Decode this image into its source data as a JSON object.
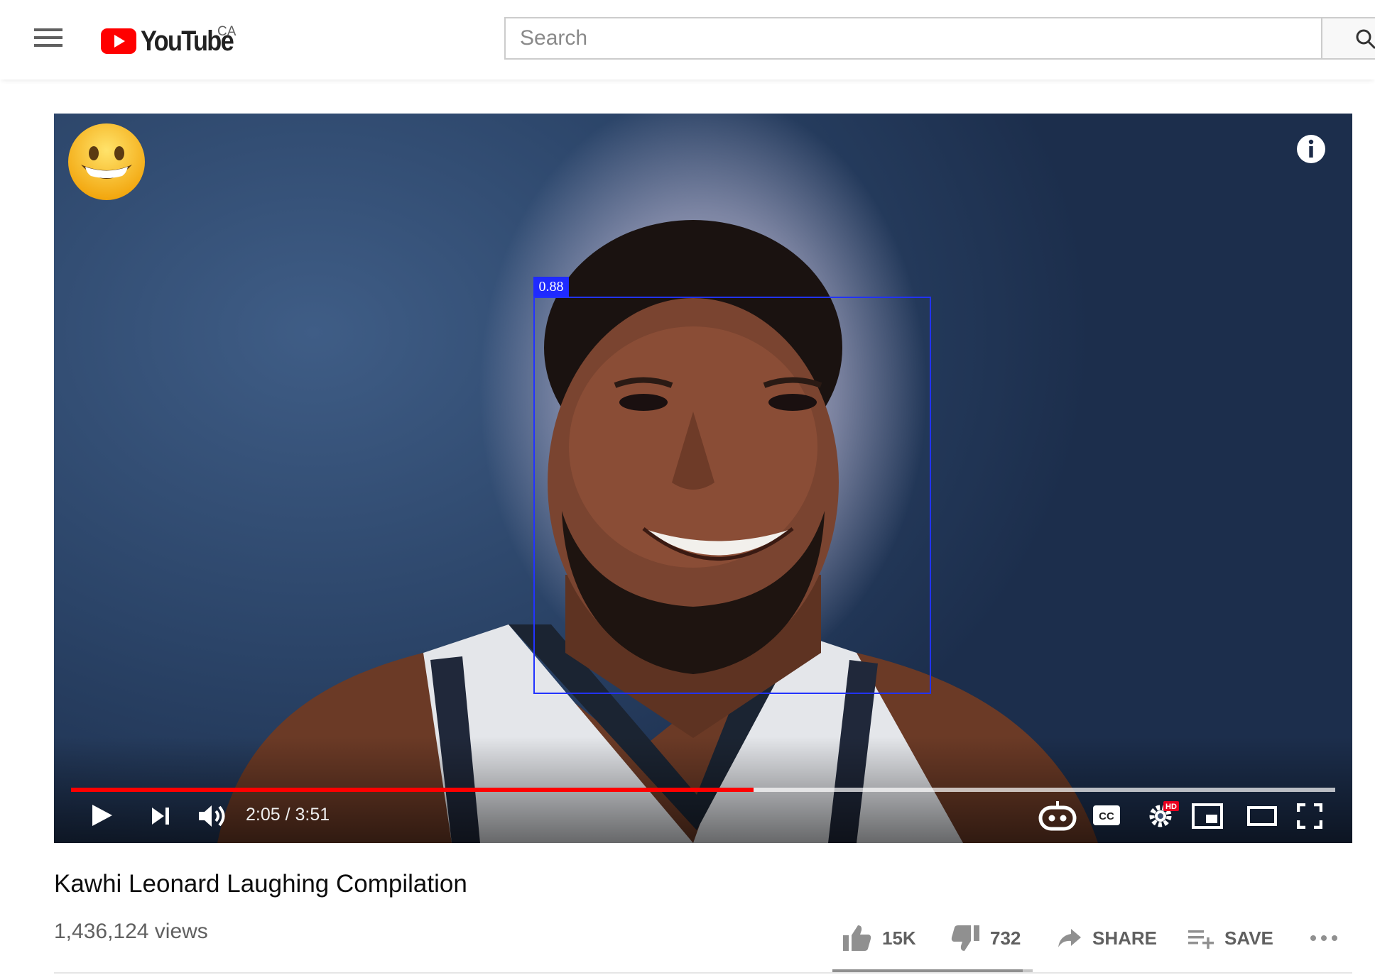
{
  "brand": {
    "name": "YouTube",
    "country": "CA",
    "logo_red": "#ff0000"
  },
  "search": {
    "placeholder": "Search",
    "value": ""
  },
  "player": {
    "detection": {
      "label": "0.88",
      "box_color": "#1f2aff"
    },
    "time": {
      "current": "2:05",
      "separator": "/",
      "total": "3:51"
    },
    "progress": {
      "played_fraction": 0.54,
      "buffered_fraction": 1.0,
      "played_color": "#ff0000"
    },
    "overlay_emoji": "grinning-face",
    "icons": {
      "play": "play-icon",
      "next": "next-icon",
      "volume": "volume-icon",
      "autoplay": "autoplay-robot-icon",
      "captions": "cc-icon",
      "settings": "gear-hd-icon",
      "miniplayer": "miniplayer-icon",
      "theater": "theater-icon",
      "fullscreen": "fullscreen-icon",
      "info": "info-icon"
    },
    "hd_badge": "HD",
    "cc_text": "CC"
  },
  "video": {
    "title": "Kawhi Leonard Laughing Compilation",
    "views": "1,436,124 views",
    "like_fraction": 0.95
  },
  "actions": {
    "like": "15K",
    "dislike": "732",
    "share": "SHARE",
    "save": "SAVE"
  }
}
